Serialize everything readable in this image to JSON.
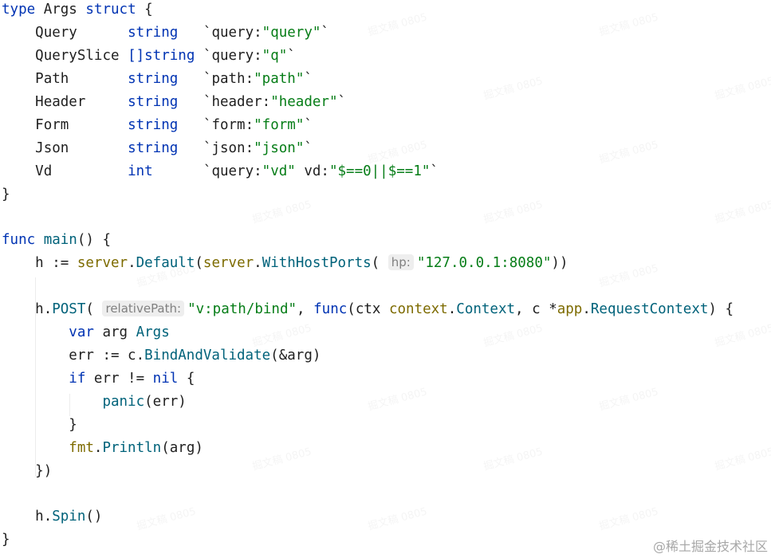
{
  "code": {
    "kw_type": "type",
    "struct_name": "Args",
    "kw_struct": "struct",
    "open_brace": "{",
    "close_brace": "}",
    "fields": [
      {
        "name": "Query",
        "type": "string",
        "tag_key": "query:",
        "tag_val": "\"query\""
      },
      {
        "name": "QuerySlice",
        "type": "[]string",
        "tag_key": "query:",
        "tag_val": "\"q\""
      },
      {
        "name": "Path",
        "type": "string",
        "tag_key": "path:",
        "tag_val": "\"path\""
      },
      {
        "name": "Header",
        "type": "string",
        "tag_key": "header:",
        "tag_val": "\"header\""
      },
      {
        "name": "Form",
        "type": "string",
        "tag_key": "form:",
        "tag_val": "\"form\""
      },
      {
        "name": "Json",
        "type": "string",
        "tag_key": "json:",
        "tag_val": "\"json\""
      },
      {
        "name": "Vd",
        "type": "int",
        "tag_key": "query:",
        "tag_val": "\"vd\"",
        "tag_key2": "vd:",
        "tag_val2": "\"$==0||$==1\""
      }
    ],
    "backtick": "`",
    "kw_func": "func",
    "main_name": "main",
    "main_sig": "() {",
    "h_assign": "h := ",
    "server_pkg": "server",
    "default_fn": "Default",
    "with_host_ports": "WithHostPorts",
    "hp_hint": "hp:",
    "host_addr": "\"127.0.0.1:8080\"",
    "close_paren2": "))",
    "h_dot": "h.",
    "post_fn": "POST",
    "open_paren": "(",
    "path_hint": "relativePath:",
    "route": "\"v:path/bind\"",
    "comma_sp": ", ",
    "ctx_param": "(ctx ",
    "context_pkg": "context",
    "context_type": "Context",
    "c_param": ", c *",
    "app_pkg": "app",
    "request_ctx": "RequestContext",
    "paren_brace": ") {",
    "kw_var": "var",
    "arg_name": " arg ",
    "args_type": "Args",
    "err_assign": "err := c.",
    "bind_fn": "BindAndValidate",
    "bind_args": "(&arg)",
    "kw_if": "if",
    "err_neq": " err != ",
    "kw_nil": "nil",
    "brace_open_sp": " {",
    "panic_fn": "panic",
    "panic_args": "(err)",
    "fmt_pkg": "fmt",
    "println_fn": "Println",
    "println_args": "(arg)",
    "close_func": "})",
    "spin_fn": "Spin",
    "empty_call": "()"
  },
  "watermark_text": "掘文稿 0805",
  "credit": "@稀土掘金技术社区",
  "colors": {
    "keyword": "#0033b3",
    "function": "#00627a",
    "package": "#7d6b00",
    "string": "#067d17",
    "hint_bg": "#eeeeee",
    "hint_fg": "#808080"
  }
}
